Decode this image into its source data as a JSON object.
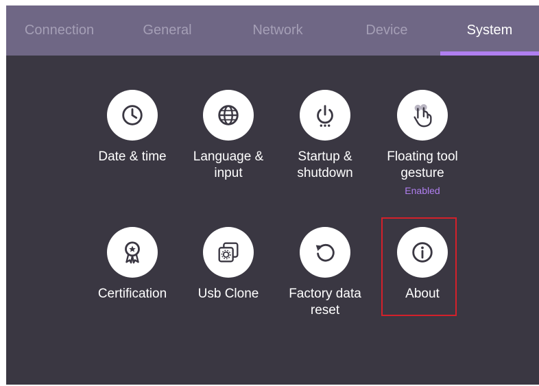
{
  "tabs": [
    {
      "label": "Connection"
    },
    {
      "label": "General"
    },
    {
      "label": "Network"
    },
    {
      "label": "Device"
    },
    {
      "label": "System"
    }
  ],
  "active_tab": "System",
  "items": [
    {
      "label": "Date & time",
      "icon": "clock-icon"
    },
    {
      "label": "Language & input",
      "icon": "globe-icon"
    },
    {
      "label": "Startup & shutdown",
      "icon": "power-icon"
    },
    {
      "label": "Floating tool gesture",
      "icon": "gesture-icon",
      "status": "Enabled"
    },
    {
      "label": "Certification",
      "icon": "award-ribbon-icon"
    },
    {
      "label": "Usb Clone",
      "icon": "usb-clone-icon"
    },
    {
      "label": "Factory data reset",
      "icon": "reset-icon"
    },
    {
      "label": "About",
      "icon": "info-icon"
    }
  ],
  "colors": {
    "background": "#3a3742",
    "tab_bar": "#6f6785",
    "accent": "#b07ff0",
    "highlight_box": "#d4202a"
  }
}
